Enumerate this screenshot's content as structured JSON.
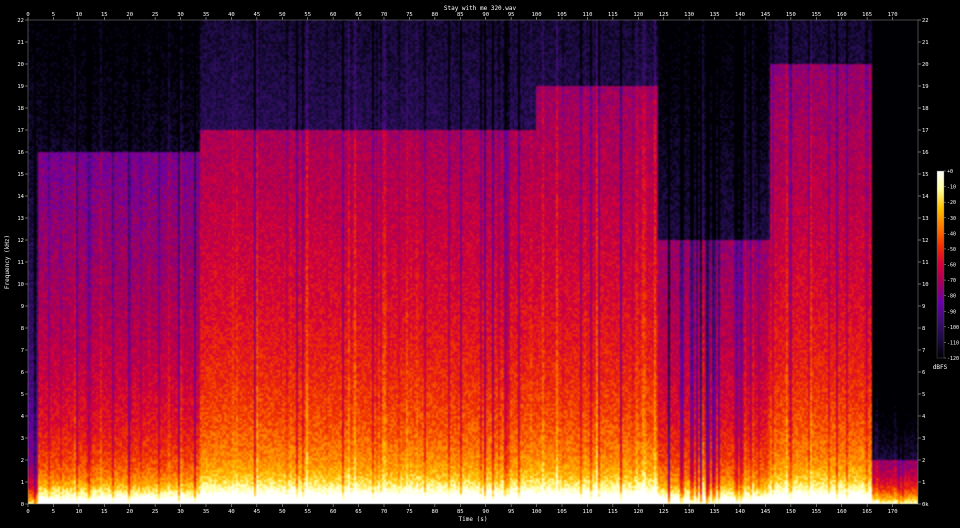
{
  "chart_data": {
    "type": "heatmap",
    "title": "Stay with me 320.wav",
    "xlabel": "Time (s)",
    "ylabel": "Frequency (kHz)",
    "xlim": [
      0,
      175
    ],
    "ylim": [
      0,
      22
    ],
    "x_ticks": [
      0,
      5,
      10,
      15,
      20,
      25,
      30,
      35,
      40,
      45,
      50,
      55,
      60,
      65,
      70,
      75,
      80,
      85,
      90,
      95,
      100,
      105,
      110,
      115,
      120,
      125,
      130,
      135,
      140,
      145,
      150,
      155,
      160,
      165,
      170
    ],
    "y_ticks": [
      0,
      1,
      2,
      3,
      4,
      5,
      6,
      7,
      8,
      9,
      10,
      11,
      12,
      13,
      14,
      15,
      16,
      17,
      18,
      19,
      20,
      21,
      22
    ],
    "x_tick_labels": [
      "0",
      "5",
      "10",
      "15",
      "20",
      "25",
      "30",
      "35",
      "40",
      "45",
      "50",
      "55",
      "60",
      "65",
      "70",
      "75",
      "80",
      "85",
      "90",
      "95",
      "100",
      "105",
      "110",
      "115",
      "120",
      "125",
      "130",
      "135",
      "140",
      "145",
      "150",
      "155",
      "160",
      "165",
      "170"
    ],
    "y_tick_labels": [
      "0",
      "1",
      "2",
      "3",
      "4",
      "5",
      "6",
      "7",
      "8",
      "9",
      "10",
      "11",
      "12",
      "13",
      "14",
      "15",
      "16",
      "17",
      "18",
      "19",
      "20",
      "21",
      "22"
    ],
    "y_tick_labels_right": [
      "0k",
      "1",
      "2",
      "3",
      "4",
      "5",
      "6",
      "7",
      "8",
      "9",
      "10",
      "11",
      "12",
      "13",
      "14",
      "15",
      "16",
      "17",
      "18",
      "19",
      "20",
      "21",
      "22"
    ],
    "colorbar": {
      "label": "dBFS",
      "ticks": [
        0,
        -10,
        -20,
        -30,
        -40,
        -50,
        -60,
        -70,
        -80,
        -90,
        -100,
        -110,
        -120
      ],
      "tick_labels": [
        "+0",
        "-10",
        "-20",
        "-30",
        "-40",
        "-50",
        "-60",
        "-70",
        "-80",
        "-90",
        "-100",
        "-110",
        "-120"
      ],
      "range": [
        -120,
        0
      ]
    },
    "colormap": [
      "#000004",
      "#1b0c41",
      "#3b0f70",
      "#6a00a8",
      "#a0005a",
      "#d4003c",
      "#f03000",
      "#ff7a00",
      "#ffc000",
      "#ffff9a",
      "#ffffff"
    ],
    "energy_envelope": {
      "segments": [
        {
          "t": [
            0,
            2
          ],
          "cutoff_khz": 22,
          "level": "low"
        },
        {
          "t": [
            2,
            34
          ],
          "cutoff_khz": 16,
          "level": "medium"
        },
        {
          "t": [
            34,
            100
          ],
          "cutoff_khz": 17,
          "level": "high"
        },
        {
          "t": [
            100,
            124
          ],
          "cutoff_khz": 19,
          "level": "high"
        },
        {
          "t": [
            124,
            146
          ],
          "cutoff_khz": 12,
          "level": "medium"
        },
        {
          "t": [
            146,
            166
          ],
          "cutoff_khz": 20,
          "level": "high"
        },
        {
          "t": [
            166,
            175
          ],
          "cutoff_khz": 2,
          "level": "fade"
        }
      ]
    },
    "grid": false
  }
}
